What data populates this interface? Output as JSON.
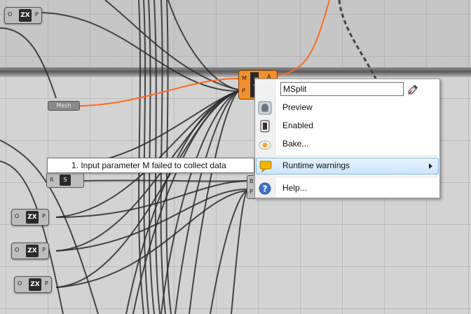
{
  "canvas": {
    "mesh_param_label": "Mesh",
    "msplit_component": {
      "input_m": "M",
      "input_p": "P",
      "output_a": "A",
      "nickname": "MSplit"
    },
    "zx_components": [
      {
        "in": "O",
        "tag": "ZX",
        "out": "P"
      },
      {
        "in": "O",
        "tag": "ZX",
        "out": "P"
      },
      {
        "in": "O",
        "tag": "ZX",
        "out": "P"
      },
      {
        "in": "O",
        "tag": "ZX",
        "out": "P"
      }
    ],
    "rs_component": {
      "in": "R",
      "tag": "S"
    },
    "p_component": {
      "b": "B",
      "p": "P"
    }
  },
  "tooltip": {
    "message": "1. Input parameter M failed to collect data"
  },
  "context_menu": {
    "name_value": "MSplit",
    "items": {
      "preview": "Preview",
      "enabled": "Enabled",
      "bake": "Bake...",
      "runtime_warnings": "Runtime warnings",
      "help": "Help..."
    }
  },
  "colors": {
    "canvas_bg": "#d3d3d3",
    "active_wire": "#ff6a1f",
    "component_orange": "#f2902e",
    "menu_highlight": "#cde6fb",
    "warning_icon": "#f5b400"
  },
  "icons": {
    "preview": "preview-ghost-icon",
    "enabled": "enabled-toggle-icon",
    "bake": "bake-egg-icon",
    "runtime_warnings": "warning-balloon-icon",
    "help": "help-question-icon",
    "eyedropper": "color-picker-icon"
  }
}
